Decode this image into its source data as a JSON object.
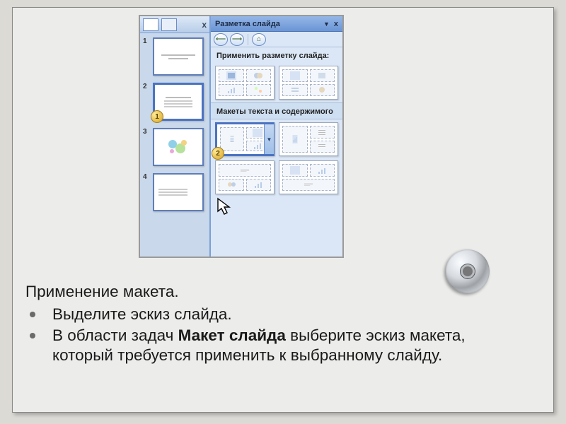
{
  "taskpane": {
    "title": "Разметка слайда",
    "subheader": "Применить разметку слайда:",
    "section_label": "Макеты текста и содержимого"
  },
  "thumbs": {
    "numbers": [
      "1",
      "2",
      "3",
      "4"
    ],
    "badge1": "1",
    "badge2": "2"
  },
  "body": {
    "title": "Применение макета.",
    "bullet1": "Выделите эскиз слайда.",
    "bullet2_a": "В области задач ",
    "bullet2_bold": "Макет слайда",
    "bullet2_b": " выберите эскиз макета, который требуется применить к выбранному слайду."
  },
  "icons": {
    "close": "x",
    "caret": "▼",
    "back": "⟵",
    "fwd": "⟶",
    "home": "⌂"
  }
}
